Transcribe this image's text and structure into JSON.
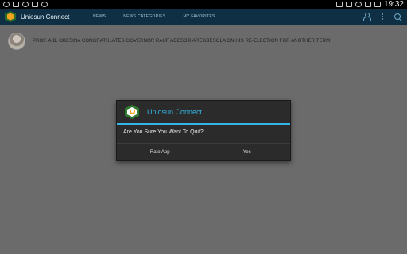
{
  "status_bar": {
    "time": "19:32",
    "left_icons": [
      "wifi-icon",
      "usb-icon",
      "whatsapp-icon",
      "image-icon",
      "notification-icon"
    ],
    "right_icons": [
      "bluetooth-icon",
      "mute-icon",
      "wifi-icon",
      "airplane-icon",
      "battery-icon"
    ]
  },
  "action_bar": {
    "app_title": "Uniosun Connect",
    "tabs": [
      {
        "label": "NEWS"
      },
      {
        "label": "NEWS CATEGORIES"
      },
      {
        "label": "MY FAVORITES"
      }
    ],
    "icons": [
      "person-icon",
      "overflow-menu-icon",
      "search-icon"
    ]
  },
  "news": {
    "items": [
      {
        "title": "PROF. A.B. OKESINA CONGRATULATES GOVERNOR RAUF ADESOJI AREGBESOLA ON HIS RE-ELECTION FOR ANOTHER TERM"
      }
    ]
  },
  "dialog": {
    "title": "Uniosun Connect",
    "message": "Are You Sure You Want To Quit?",
    "buttons": {
      "rate_label": "Rate App",
      "yes_label": "Yes"
    }
  },
  "colors": {
    "accent": "#33b5e5",
    "action_bar": "#0f2f44",
    "dim_background": "#6b6b6b"
  }
}
